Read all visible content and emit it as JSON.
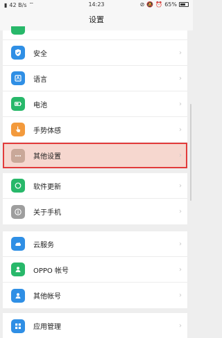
{
  "status": {
    "speed": "42 B/s",
    "time": "14:23",
    "battery": "65%"
  },
  "header": {
    "title": "设置"
  },
  "groups": [
    {
      "items": [
        {
          "label": "",
          "icon": "partial-icon",
          "color": "#28b86a"
        },
        {
          "label": "安全",
          "icon": "shield-icon",
          "color": "#2f8fe5"
        },
        {
          "label": "语言",
          "icon": "language-icon",
          "color": "#2f8fe5"
        },
        {
          "label": "电池",
          "icon": "battery-icon",
          "color": "#28b86a"
        },
        {
          "label": "手势体感",
          "icon": "gesture-icon",
          "color": "#f39a3c"
        },
        {
          "label": "其他设置",
          "icon": "more-icon",
          "color": "#c9a899"
        }
      ]
    },
    {
      "items": [
        {
          "label": "软件更新",
          "icon": "update-icon",
          "color": "#28b86a"
        },
        {
          "label": "关于手机",
          "icon": "info-icon",
          "color": "#9e9e9e"
        }
      ]
    },
    {
      "items": [
        {
          "label": "云服务",
          "icon": "cloud-icon",
          "color": "#2f8fe5"
        },
        {
          "label": "OPPO 帐号",
          "icon": "user-icon",
          "color": "#28b86a"
        },
        {
          "label": "其他帐号",
          "icon": "account-icon",
          "color": "#2f8fe5"
        }
      ]
    },
    {
      "items": [
        {
          "label": "应用管理",
          "icon": "apps-icon",
          "color": "#2f8fe5"
        }
      ]
    }
  ]
}
